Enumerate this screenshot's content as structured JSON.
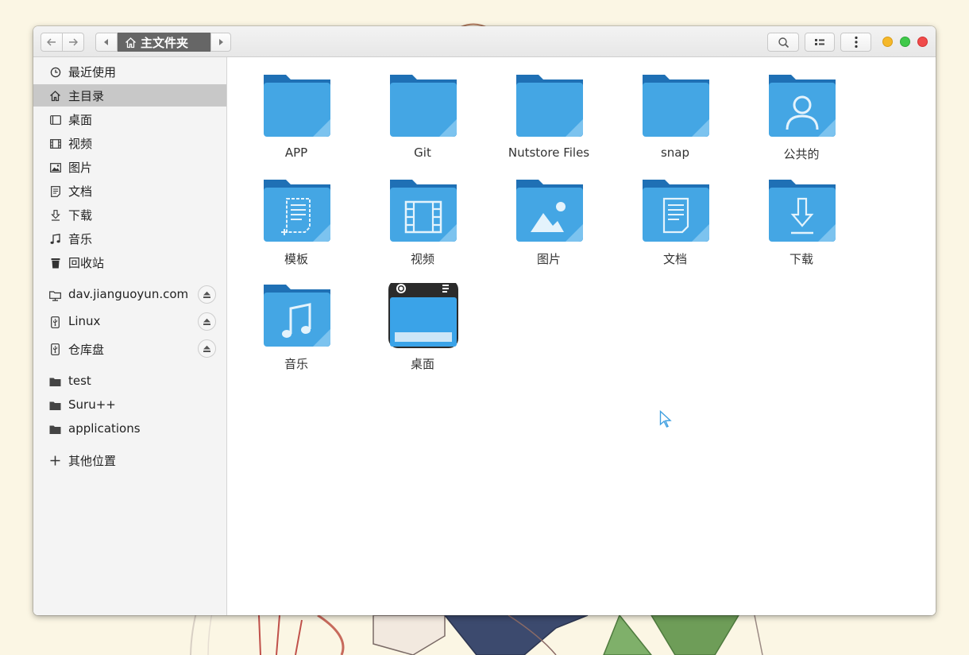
{
  "window": {
    "breadcrumb": "主文件夹",
    "colors": {
      "folder_front": "#44a6e4",
      "folder_back": "#1f70b5",
      "accent": "#44a6e4"
    }
  },
  "sidebar": {
    "places": [
      {
        "label": "最近使用",
        "icon": "clock-icon"
      },
      {
        "label": "主目录",
        "icon": "home-icon"
      },
      {
        "label": "桌面",
        "icon": "desktop-icon"
      },
      {
        "label": "视频",
        "icon": "film-icon"
      },
      {
        "label": "图片",
        "icon": "image-icon"
      },
      {
        "label": "文档",
        "icon": "document-icon"
      },
      {
        "label": "下载",
        "icon": "download-icon"
      },
      {
        "label": "音乐",
        "icon": "music-icon"
      },
      {
        "label": "回收站",
        "icon": "trash-icon"
      }
    ],
    "devices": [
      {
        "label": "dav.jianguoyun.com",
        "icon": "network-folder-icon"
      },
      {
        "label": "Linux",
        "icon": "usb-drive-icon"
      },
      {
        "label": "仓库盘",
        "icon": "usb-drive-icon"
      }
    ],
    "bookmarks": [
      {
        "label": "test",
        "icon": "folder-icon"
      },
      {
        "label": "Suru++",
        "icon": "folder-icon"
      },
      {
        "label": "applications",
        "icon": "folder-icon"
      }
    ],
    "other_locations": "其他位置"
  },
  "content": {
    "items": [
      {
        "label": "APP",
        "icon": "folder-icon"
      },
      {
        "label": "Git",
        "icon": "folder-icon"
      },
      {
        "label": "Nutstore Files",
        "icon": "folder-icon"
      },
      {
        "label": "snap",
        "icon": "folder-icon"
      },
      {
        "label": "公共的",
        "icon": "public-folder-icon"
      },
      {
        "label": "模板",
        "icon": "templates-folder-icon"
      },
      {
        "label": "视频",
        "icon": "videos-folder-icon"
      },
      {
        "label": "图片",
        "icon": "pictures-folder-icon"
      },
      {
        "label": "文档",
        "icon": "documents-folder-icon"
      },
      {
        "label": "下载",
        "icon": "downloads-folder-icon"
      },
      {
        "label": "音乐",
        "icon": "music-folder-icon"
      },
      {
        "label": "桌面",
        "icon": "desktop-folder-icon"
      }
    ]
  }
}
